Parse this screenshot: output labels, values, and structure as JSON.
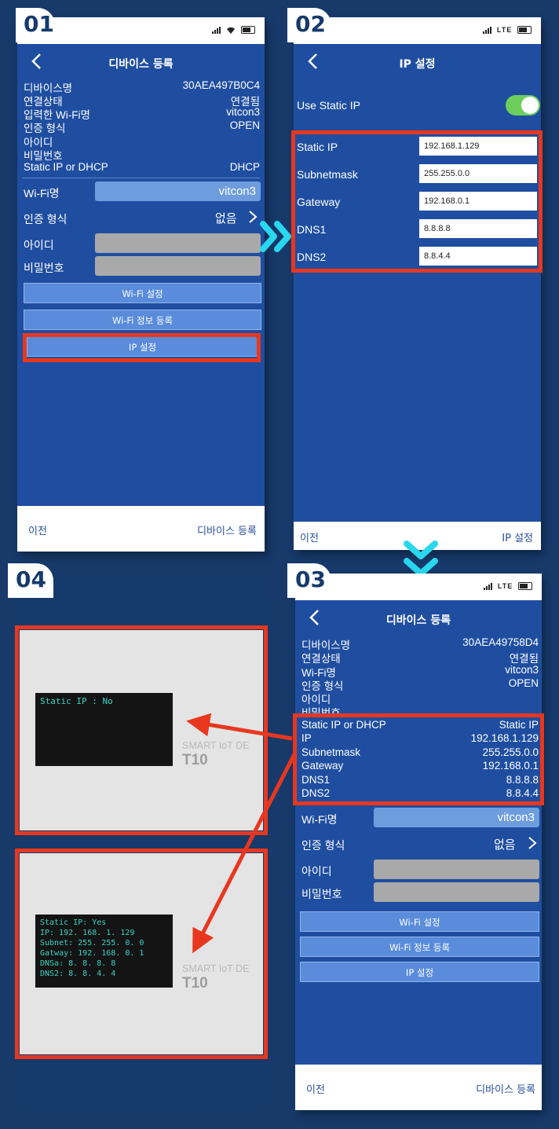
{
  "step_badges": {
    "step1": "01",
    "step2": "02",
    "step3": "03",
    "step4": "04"
  },
  "colors": {
    "background": "#173a6b",
    "app_blue": "#1f4ea0",
    "highlight_red": "#e8371f",
    "arrow_cyan": "#29d7ee",
    "lcd_text": "#35d6c3"
  },
  "screen1": {
    "title": "디바이스 등록",
    "info": [
      {
        "key": "디바이스명",
        "value": "30AEA497B0C4"
      },
      {
        "key": "연결상태",
        "value": "연결됨"
      },
      {
        "key": "입력한 Wi-Fi명",
        "value": "vitcon3"
      },
      {
        "key": "인증 형식",
        "value": "OPEN"
      },
      {
        "key": "아이디",
        "value": ""
      },
      {
        "key": "비밀번호",
        "value": ""
      },
      {
        "key": "Static IP or DHCP",
        "value": "DHCP"
      }
    ],
    "form": {
      "wifi_label": "Wi-Fi명",
      "wifi_value": "vitcon3",
      "auth_label": "인증 형식",
      "auth_value": "없음",
      "id_label": "아이디",
      "pw_label": "비밀번호"
    },
    "buttons": {
      "wifi_setting": "Wi-Fi 설정",
      "wifi_register": "Wi-Fi 정보 등록",
      "ip_setting": "IP 설정"
    },
    "bottom": {
      "left": "이전",
      "right": "디바이스 등록"
    }
  },
  "screen2": {
    "title": "IP 설정",
    "use_static_label": "Use Static IP",
    "use_static_on": true,
    "fields": [
      {
        "label": "Static IP",
        "value": "192.168.1.129"
      },
      {
        "label": "Subnetmask",
        "value": "255.255.0.0"
      },
      {
        "label": "Gateway",
        "value": "192.168.0.1"
      },
      {
        "label": "DNS1",
        "value": "8.8.8.8"
      },
      {
        "label": "DNS2",
        "value": "8.8.4.4"
      }
    ],
    "bottom": {
      "left": "이전",
      "right": "IP 설정"
    }
  },
  "screen3": {
    "title": "디바이스 등록",
    "info": [
      {
        "key": "디바이스명",
        "value": "30AEA49758D4"
      },
      {
        "key": "연결상태",
        "value": "연결됨"
      },
      {
        "key": "Wi-Fi명",
        "value": "vitcon3"
      },
      {
        "key": "인증 형식",
        "value": "OPEN"
      },
      {
        "key": "아이디",
        "value": ""
      },
      {
        "key": "비밀번호",
        "value": ""
      }
    ],
    "ip_info": [
      {
        "key": "Static IP or DHCP",
        "value": "Static IP"
      },
      {
        "key": "IP",
        "value": "192.168.1.129"
      },
      {
        "key": "Subnetmask",
        "value": "255.255.0.0"
      },
      {
        "key": "Gateway",
        "value": "192.168.0.1"
      },
      {
        "key": "DNS1",
        "value": "8.8.8.8"
      },
      {
        "key": "DNS2",
        "value": "8.8.4.4"
      }
    ],
    "form": {
      "wifi_label": "Wi-Fi명",
      "wifi_value": "vitcon3",
      "auth_label": "인증 형식",
      "auth_value": "없음",
      "id_label": "아이디",
      "pw_label": "비밀번호"
    },
    "buttons": {
      "wifi_setting": "Wi-Fi 설정",
      "wifi_register": "Wi-Fi 정보 등록",
      "ip_setting": "IP 설정"
    },
    "bottom": {
      "left": "이전",
      "right": "디바이스 등록"
    }
  },
  "screen4": {
    "device_top": {
      "lcd": "Static IP : No",
      "brand_line": "SMART IoT DE",
      "model": "T10"
    },
    "device_bottom": {
      "lcd_lines": [
        "Static IP: Yes",
        "IP: 192. 168. 1. 129",
        "Subnet: 255. 255. 0. 0",
        "Gatway: 192. 168. 0. 1",
        "DNSa: 8. 8. 8. 8",
        "DNS2: 8. 8. 4. 4"
      ],
      "brand_line": "SMART IoT DE",
      "model": "T10"
    }
  }
}
